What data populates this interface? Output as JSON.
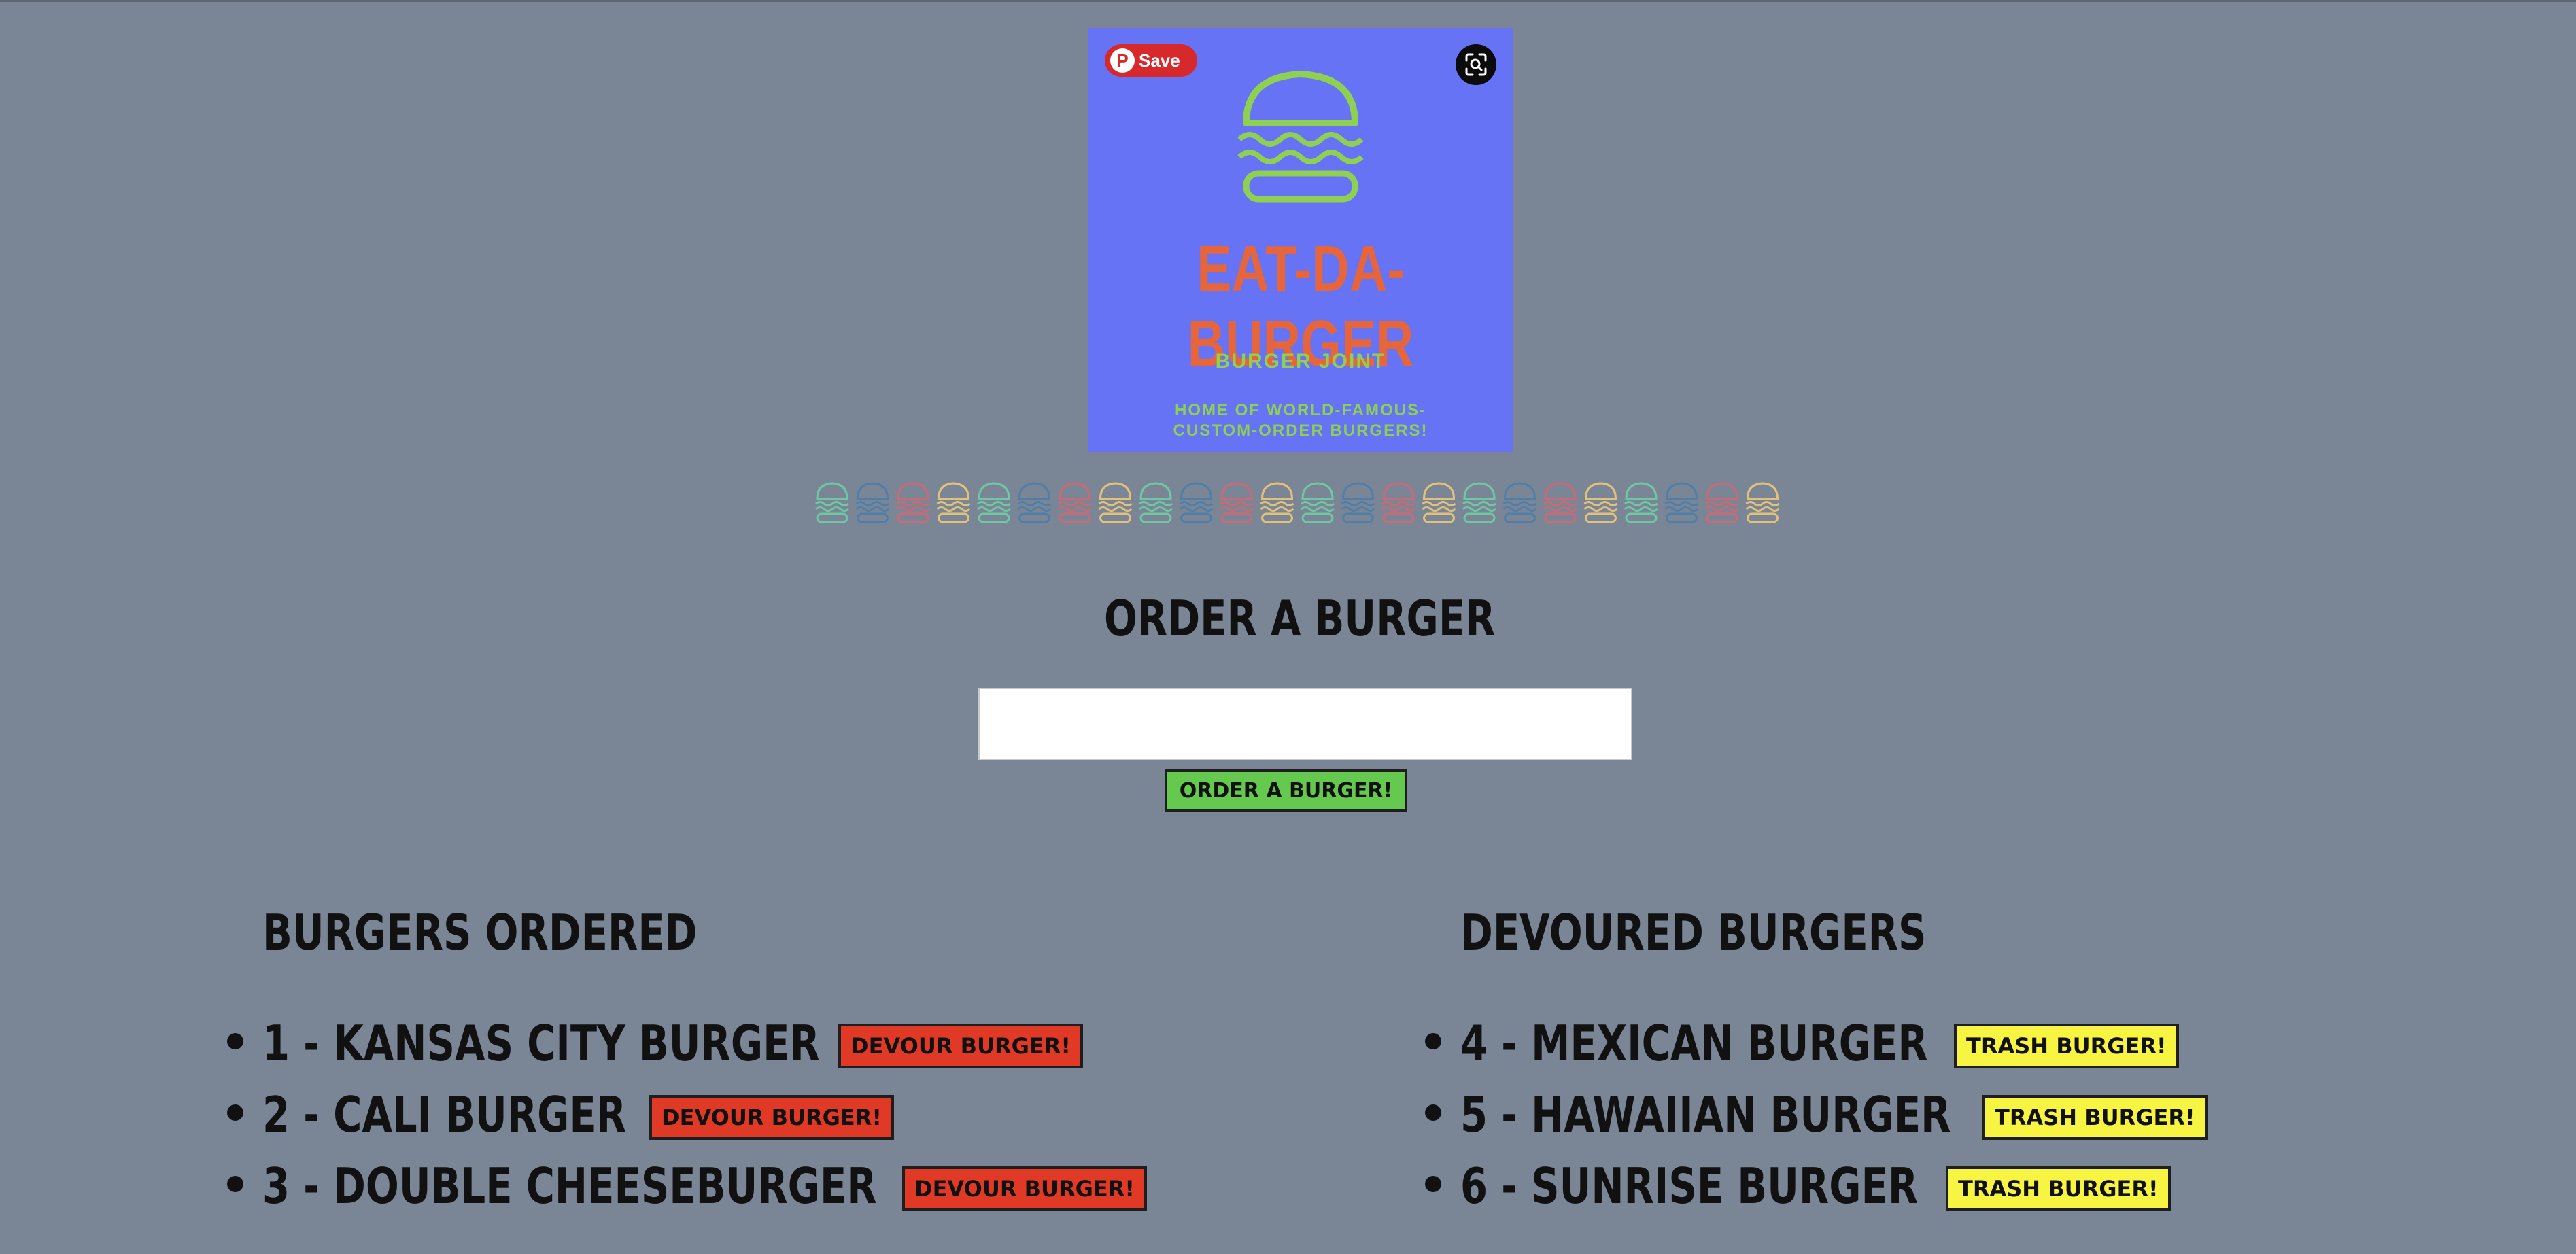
{
  "logo": {
    "brand": "EAT-DA-BURGER",
    "tagline": "BURGER JOINT",
    "subline": "HOME OF WORLD-FAMOUS-CUSTOM-ORDER BURGERS!",
    "colors": {
      "background": "#6573f4",
      "brand": "#e7653a",
      "accent": "#8fd052"
    }
  },
  "pinterest": {
    "save_label": "Save",
    "icon": "pinterest-icon"
  },
  "lens": {
    "icon": "visual-search-icon"
  },
  "burger_row_colors": [
    "#6fc7a3",
    "#4f7fa8",
    "#c96a77",
    "#e2c27a",
    "#6fc7a3",
    "#4f7fa8",
    "#c96a77",
    "#e2c27a",
    "#6fc7a3",
    "#4f7fa8",
    "#c96a77",
    "#e2c27a",
    "#6fc7a3",
    "#4f7fa8",
    "#c96a77",
    "#e2c27a",
    "#6fc7a3",
    "#4f7fa8",
    "#c96a77",
    "#e2c27a",
    "#6fc7a3",
    "#4f7fa8",
    "#c96a77",
    "#e2c27a"
  ],
  "order": {
    "title": "Order a burger",
    "input_value": "",
    "button_label": "Order a burger!"
  },
  "ordered": {
    "title": "Burgers ordered",
    "items": [
      {
        "text": "1 - Kansas City Burger",
        "action": "Devour Burger!"
      },
      {
        "text": "2 - Cali Burger",
        "action": "Devour Burger!"
      },
      {
        "text": "3 - Double Cheeseburger",
        "action": "Devour Burger!"
      }
    ]
  },
  "devoured": {
    "title": "Devoured burgers",
    "items": [
      {
        "text": "4 - Mexican Burger",
        "action": "Trash Burger!"
      },
      {
        "text": "5 - Hawaiian Burger",
        "action": "Trash Burger!"
      },
      {
        "text": "6 - Sunrise Burger",
        "action": "Trash Burger!"
      }
    ]
  },
  "colors": {
    "page_bg": "#7a8696",
    "order_button": "#66c94f",
    "devour_button": "#e03a26",
    "trash_button": "#f8f542"
  }
}
